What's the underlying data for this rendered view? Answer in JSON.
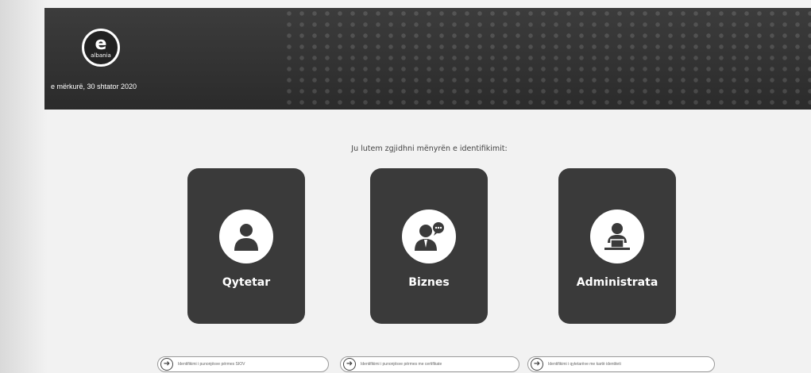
{
  "header": {
    "logo_letter": "e",
    "logo_word": "albania",
    "date": "e mërkurë, 30 shtator 2020"
  },
  "main": {
    "prompt": "Ju lutem zgjidhni mënyrën e identifikimit:",
    "cards": [
      {
        "label": "Qytetar",
        "icon": "citizen-icon"
      },
      {
        "label": "Biznes",
        "icon": "business-icon"
      },
      {
        "label": "Administrata",
        "icon": "administration-icon"
      }
    ]
  },
  "footer": {
    "buttons": [
      {
        "label": "Identifikimi i punonjësve përmes SIOV",
        "icon": "arrow-right-icon"
      },
      {
        "label": "Identifikimi i punonjësve përmes me certifikate",
        "icon": "arrow-right-icon"
      },
      {
        "label": "Identifikimi i qytetarëve me kartë identiteti",
        "icon": "arrow-right-icon"
      }
    ]
  },
  "colors": {
    "header_bg": "#2f2f2f",
    "card_bg": "#3a3a3a",
    "page_bg": "#f2f2f2"
  }
}
